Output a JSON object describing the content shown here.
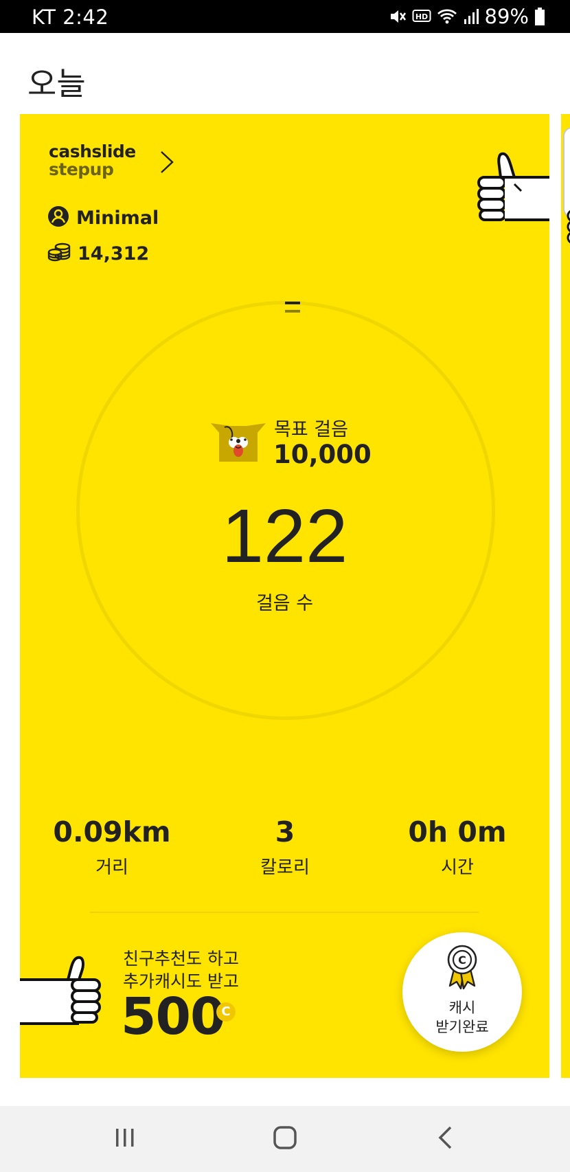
{
  "status_bar": {
    "carrier_time": "KT 2:42",
    "battery_percent": "89%",
    "icons": [
      "mute-icon",
      "hd-icon",
      "wifi-icon",
      "signal-icon",
      "battery-icon"
    ]
  },
  "header": {
    "title": "오늘"
  },
  "card": {
    "background_color": "#ffe400",
    "brand": {
      "line1": "cashslide",
      "line2": "stepup"
    },
    "user": {
      "name": "Minimal"
    },
    "coins": {
      "balance": "14,312"
    },
    "goal": {
      "label": "목표 걸음",
      "value": "10,000"
    },
    "steps": {
      "count": "122",
      "label": "걸음 수"
    },
    "stats": [
      {
        "value": "0.09km",
        "label": "거리"
      },
      {
        "value": "3",
        "label": "칼로리"
      },
      {
        "value": "0h 0m",
        "label": "시간"
      }
    ],
    "promo": {
      "line1": "친구추천도 하고",
      "line2": "추가캐시도 받고",
      "amount": "500",
      "currency_symbol": "C"
    },
    "cash_button": {
      "line1": "캐시",
      "line2": "받기완료",
      "medal_symbol": "C"
    }
  },
  "nav_bar": {
    "icons": [
      "recents-icon",
      "home-icon",
      "back-icon"
    ]
  }
}
